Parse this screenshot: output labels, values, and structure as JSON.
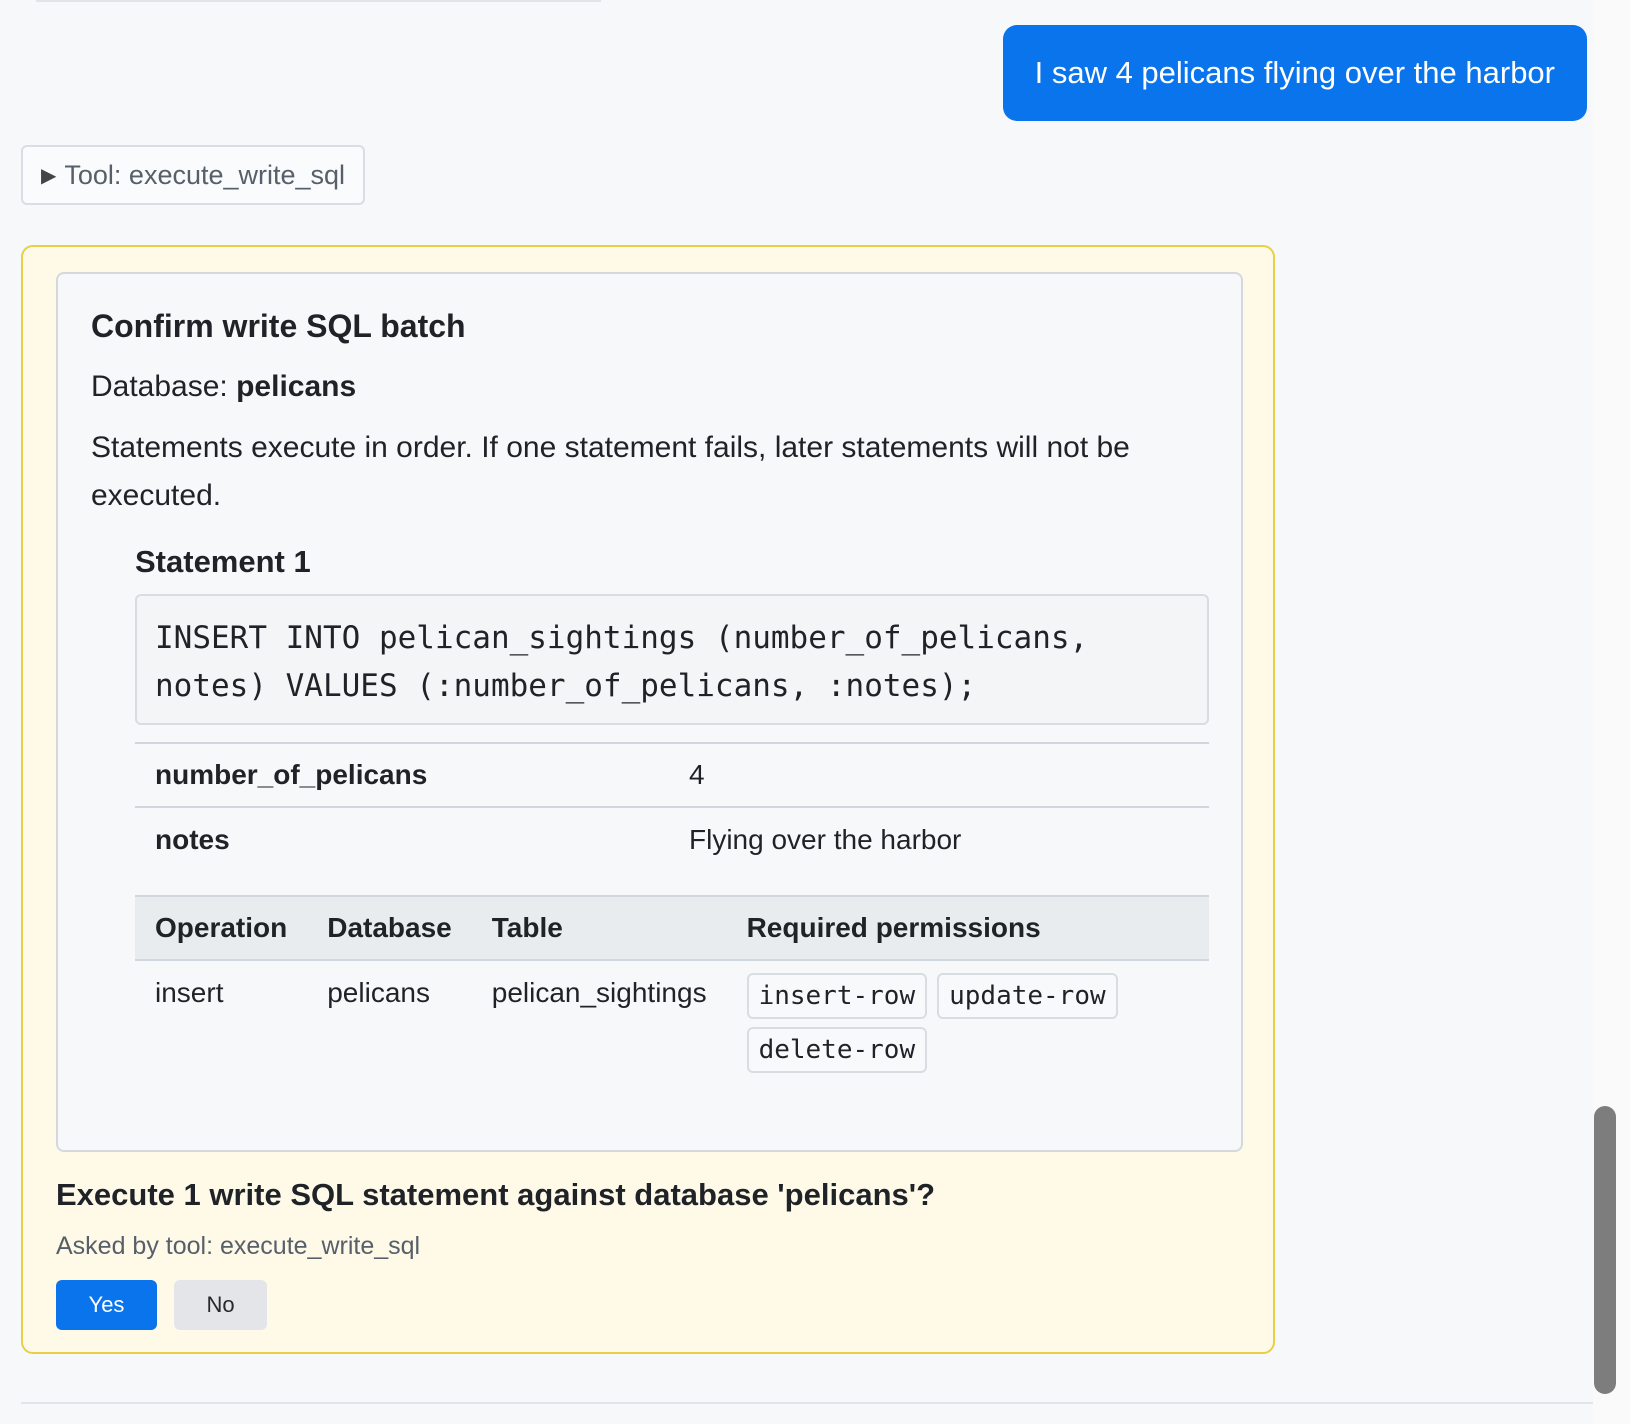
{
  "user_message": "I saw 4 pelicans flying over the harbor",
  "tool_toggle": {
    "icon": "triangle-right-icon",
    "label": "Tool: execute_write_sql"
  },
  "batch": {
    "title": "Confirm write SQL batch",
    "database_prefix": "Database:",
    "database_name": "pelicans",
    "order_note": "Statements execute in order. If one statement fails, later statements will not be executed.",
    "statement": {
      "title": "Statement 1",
      "sql": "INSERT INTO pelican_sightings (number_of_pelicans, notes) VALUES (:number_of_pelicans, :notes);",
      "params": [
        {
          "name": "number_of_pelicans",
          "value": "4"
        },
        {
          "name": "notes",
          "value": "Flying over the harbor"
        }
      ],
      "ops_headers": [
        "Operation",
        "Database",
        "Table",
        "Required permissions"
      ],
      "ops_row": {
        "operation": "insert",
        "database": "pelicans",
        "table": "pelican_sightings",
        "permissions": [
          "insert-row",
          "update-row",
          "delete-row"
        ]
      }
    }
  },
  "question": "Execute 1 write SQL statement against database 'pelicans'?",
  "asked_by": "Asked by tool: execute_write_sql",
  "buttons": {
    "yes": "Yes",
    "no": "No"
  },
  "colors": {
    "accent": "#0a74ec",
    "card_border": "#e8cf4a",
    "card_bg": "#fff9e8"
  }
}
